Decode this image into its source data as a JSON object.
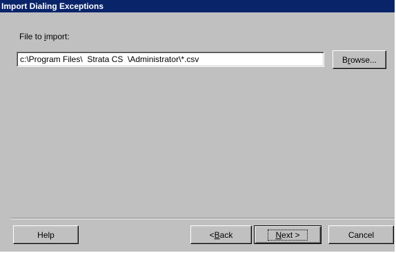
{
  "dialog": {
    "title": "Import Dialing Exceptions"
  },
  "file_import": {
    "label_prefix": "File to ",
    "label_accel": "i",
    "label_suffix": "mport:",
    "value": "c:\\Program Files\\  Strata CS  \\Administrator\\*.csv"
  },
  "browse_button": {
    "prefix": "B",
    "accel": "r",
    "suffix": "owse..."
  },
  "footer": {
    "help_label": "Help",
    "back_prefix": "< ",
    "back_accel": "B",
    "back_suffix": "ack",
    "next_accel": "N",
    "next_suffix": "ext >",
    "cancel_label": "Cancel"
  },
  "colors": {
    "title_bar": "#0a246a",
    "dialog_face": "#c0c0c0"
  }
}
